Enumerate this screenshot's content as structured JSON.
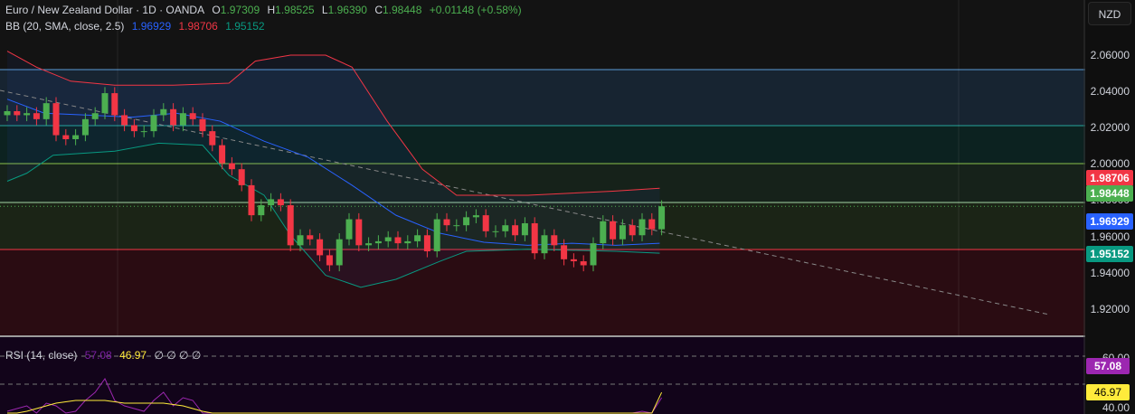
{
  "header": {
    "symbol": "Euro / New Zealand Dollar · 1D · OANDA",
    "o_label": "O",
    "o": "1.97309",
    "h_label": "H",
    "h": "1.98525",
    "l_label": "L",
    "l": "1.96390",
    "c_label": "C",
    "c": "1.98448",
    "change": "+0.01148 (+0.58%)"
  },
  "bb": {
    "label": "BB (20, SMA, close, 2.5)",
    "basis": "1.96929",
    "upper": "1.98706",
    "lower": "1.95152"
  },
  "rsi": {
    "label": "RSI (14, close)",
    "value": "57.08",
    "ma": "46.97",
    "extra": "∅ ∅ ∅ ∅"
  },
  "currency": "NZD",
  "price_axis": [
    "2.06000",
    "2.04000",
    "2.02000",
    "2.00000",
    "1.98000",
    "1.96000",
    "1.94000",
    "1.92000"
  ],
  "rsi_axis": [
    "60.00",
    "40.00"
  ],
  "tags": {
    "upper": "1.98706",
    "last": "1.98448",
    "basis": "1.96929",
    "lower": "1.95152",
    "rsi": "57.08",
    "rsi_ma": "46.97"
  },
  "colors": {
    "up": "#4caf50",
    "down": "#f23645",
    "basis": "#2962ff",
    "upper": "#f23645",
    "lower": "#089981",
    "rsi": "#9c27b0",
    "rsi_ma": "#ffeb3b"
  },
  "chart_data": {
    "type": "candlestick",
    "first_open": 2.03,
    "closes": [
      2.032,
      2.03,
      2.031,
      2.028,
      2.036,
      2.02,
      2.018,
      2.02,
      2.028,
      2.031,
      2.041,
      2.03,
      2.025,
      2.022,
      2.022,
      2.03,
      2.033,
      2.025,
      2.031,
      2.028,
      2.022,
      2.015,
      2.006,
      2.003,
      1.995,
      1.98,
      1.985,
      1.988,
      1.985,
      1.965,
      1.97,
      1.968,
      1.96,
      1.955,
      1.968,
      1.978,
      1.965,
      1.966,
      1.967,
      1.969,
      1.966,
      1.967,
      1.97,
      1.962,
      1.978,
      1.975,
      1.975,
      1.979,
      1.98,
      1.972,
      1.972,
      1.975,
      1.97,
      1.976,
      1.961,
      1.97,
      1.965,
      1.958,
      1.957,
      1.955,
      1.966,
      1.977,
      1.968,
      1.975,
      1.97,
      1.978,
      1.973,
      1.98448
    ],
    "bb_upper": [
      [
        0,
        2.062
      ],
      [
        3,
        2.054
      ],
      [
        6.5,
        2.047
      ],
      [
        11,
        2.045
      ],
      [
        17,
        2.045
      ],
      [
        22.7,
        2.046
      ],
      [
        25.4,
        2.057
      ],
      [
        29,
        2.06
      ],
      [
        32.6,
        2.06
      ],
      [
        35.3,
        2.054
      ],
      [
        38.9,
        2.027
      ],
      [
        42.5,
        2.003
      ],
      [
        46,
        1.99
      ],
      [
        53.3,
        1.99
      ],
      [
        62,
        1.992
      ],
      [
        66.8,
        1.9935
      ]
    ],
    "bb_basis": [
      [
        0,
        2.038
      ],
      [
        3.8,
        2.031
      ],
      [
        8.3,
        2.03
      ],
      [
        12.8,
        2.029
      ],
      [
        17.3,
        2.031
      ],
      [
        21.8,
        2.027
      ],
      [
        26.3,
        2.017
      ],
      [
        30.8,
        2.009
      ],
      [
        35.3,
        1.995
      ],
      [
        39.8,
        1.98
      ],
      [
        44.3,
        1.971
      ],
      [
        48.8,
        1.9665
      ],
      [
        53.3,
        1.965
      ],
      [
        57.8,
        1.966
      ],
      [
        62.3,
        1.965
      ],
      [
        66.8,
        1.966
      ]
    ],
    "bb_lower": [
      [
        0,
        1.997
      ],
      [
        2,
        2.001
      ],
      [
        4.7,
        2.01
      ],
      [
        11,
        2.012
      ],
      [
        15.5,
        2.016
      ],
      [
        20,
        2.015
      ],
      [
        22.7,
        2.0
      ],
      [
        26.3,
        1.99
      ],
      [
        29,
        1.97
      ],
      [
        32.6,
        1.95
      ],
      [
        36.2,
        1.944
      ],
      [
        39.8,
        1.948
      ],
      [
        44.3,
        1.957
      ],
      [
        47,
        1.962
      ],
      [
        53.3,
        1.963
      ],
      [
        62.3,
        1.962
      ],
      [
        66.8,
        1.961
      ]
    ],
    "rsi_values": [
      40,
      41,
      42,
      39,
      43,
      42,
      37,
      40,
      44,
      47,
      52,
      44,
      42,
      41,
      40,
      44,
      47,
      42,
      45,
      44,
      38,
      36,
      34,
      30,
      28,
      24,
      26,
      27,
      25,
      21,
      24,
      23,
      20,
      19,
      25,
      30,
      25,
      25,
      26,
      27,
      25,
      26,
      28,
      24,
      33,
      31,
      31,
      34,
      35,
      30,
      31,
      32,
      30,
      33,
      25,
      30,
      28,
      23,
      23,
      22,
      28,
      35,
      30,
      37,
      34,
      40,
      38,
      45
    ],
    "rsi_ma": [
      37,
      38,
      40,
      41,
      42,
      43,
      43.5,
      44,
      44,
      44,
      44,
      43.5,
      43,
      43,
      43,
      43,
      43,
      42.5,
      42,
      41,
      40,
      38.5,
      37,
      35,
      33,
      31,
      30,
      29,
      28,
      27,
      26,
      25,
      24.5,
      24,
      24,
      24,
      24.5,
      25,
      25.5,
      26,
      26.5,
      27,
      27.5,
      28,
      28.5,
      29,
      29.5,
      30,
      30.5,
      31,
      31.5,
      32,
      32.5,
      33,
      33,
      33,
      33,
      33,
      33,
      33,
      33.5,
      34,
      34.5,
      35,
      35.5,
      36,
      36.5,
      46.97
    ],
    "ylim": [
      1.92,
      2.06
    ],
    "rsi_ylim": [
      40,
      60
    ]
  }
}
